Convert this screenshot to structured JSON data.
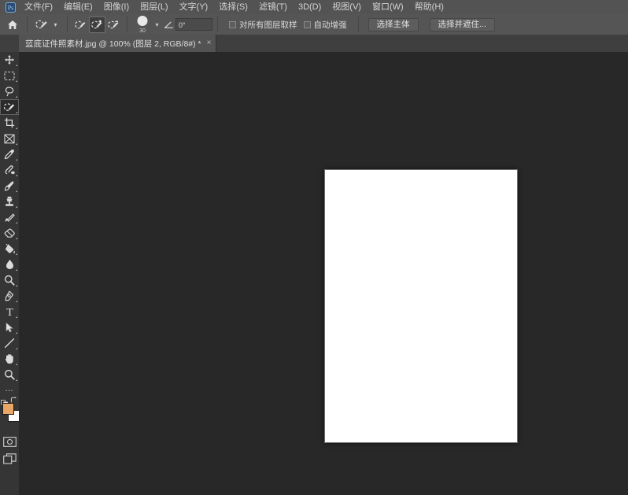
{
  "app": {
    "name": "Adobe Photoshop",
    "home_icon": "home-icon"
  },
  "menubar": {
    "items": [
      {
        "label": "文件(F)",
        "name": "menu-file"
      },
      {
        "label": "编辑(E)",
        "name": "menu-edit"
      },
      {
        "label": "图像(I)",
        "name": "menu-image"
      },
      {
        "label": "图层(L)",
        "name": "menu-layer"
      },
      {
        "label": "文字(Y)",
        "name": "menu-type"
      },
      {
        "label": "选择(S)",
        "name": "menu-select"
      },
      {
        "label": "滤镜(T)",
        "name": "menu-filter"
      },
      {
        "label": "3D(D)",
        "name": "menu-3d"
      },
      {
        "label": "视图(V)",
        "name": "menu-view"
      },
      {
        "label": "窗口(W)",
        "name": "menu-window"
      },
      {
        "label": "帮助(H)",
        "name": "menu-help"
      }
    ]
  },
  "options_bar": {
    "tool_preset_icon": "quick-selection-tool-icon",
    "preset_chevron": "▾",
    "selection_modes": [
      {
        "name": "selection-mode-new",
        "icon": "quick-selection-new-icon",
        "active": false
      },
      {
        "name": "selection-mode-add",
        "icon": "quick-selection-add-icon",
        "active": true
      },
      {
        "name": "selection-mode-subtract",
        "icon": "quick-selection-subtract-icon",
        "active": false
      }
    ],
    "brush_size": "30",
    "brush_chevron": "▾",
    "angle_icon": "angle-icon",
    "angle_value": "0°",
    "sample_all_layers_label": "对所有图层取样",
    "sample_all_layers_checked": false,
    "auto_enhance_label": "自动增强",
    "auto_enhance_checked": false,
    "select_subject_label": "选择主体",
    "select_and_mask_label": "选择并遮住..."
  },
  "tab": {
    "title": "蓝底证件照素材.jpg @ 100% (图层 2, RGB/8#) *",
    "close_label": "×"
  },
  "toolbar": {
    "tools": [
      {
        "name": "tool-move",
        "icon": "move-tool-icon",
        "active": false
      },
      {
        "name": "tool-rectangular-marquee",
        "icon": "marquee-tool-icon",
        "active": false
      },
      {
        "name": "tool-lasso",
        "icon": "lasso-tool-icon",
        "active": false
      },
      {
        "name": "tool-quick-selection",
        "icon": "quick-selection-tool-icon",
        "active": true
      },
      {
        "name": "tool-crop",
        "icon": "crop-tool-icon",
        "active": false
      },
      {
        "name": "tool-frame",
        "icon": "frame-tool-icon",
        "active": false
      },
      {
        "name": "tool-eyedropper",
        "icon": "eyedropper-tool-icon",
        "active": false
      },
      {
        "name": "tool-healing-brush",
        "icon": "healing-brush-tool-icon",
        "active": false
      },
      {
        "name": "tool-brush",
        "icon": "brush-tool-icon",
        "active": false
      },
      {
        "name": "tool-clone-stamp",
        "icon": "clone-stamp-tool-icon",
        "active": false
      },
      {
        "name": "tool-history-brush",
        "icon": "history-brush-tool-icon",
        "active": false
      },
      {
        "name": "tool-eraser",
        "icon": "eraser-tool-icon",
        "active": false
      },
      {
        "name": "tool-gradient",
        "icon": "paint-bucket-tool-icon",
        "active": false
      },
      {
        "name": "tool-blur",
        "icon": "blur-tool-icon",
        "active": false
      },
      {
        "name": "tool-dodge",
        "icon": "dodge-tool-icon",
        "active": false
      },
      {
        "name": "tool-pen",
        "icon": "pen-tool-icon",
        "active": false
      },
      {
        "name": "tool-type",
        "icon": "type-tool-icon",
        "active": false
      },
      {
        "name": "tool-path-selection",
        "icon": "path-selection-tool-icon",
        "active": false
      },
      {
        "name": "tool-line-shape",
        "icon": "line-tool-icon",
        "active": false
      },
      {
        "name": "tool-hand",
        "icon": "hand-tool-icon",
        "active": false
      },
      {
        "name": "tool-zoom",
        "icon": "zoom-tool-icon",
        "active": false
      }
    ],
    "more_tools_label": "…",
    "foreground_color": "#e9a665",
    "background_color": "#ffffff",
    "swap_colors_icon": "swap-colors-icon",
    "default_colors_icon": "default-colors-icon",
    "quick_mask_icon": "quick-mask-icon",
    "screen_mode_icon": "screen-mode-icon"
  },
  "canvas": {
    "document_background": "#ffffff",
    "workspace_background": "#282828"
  }
}
